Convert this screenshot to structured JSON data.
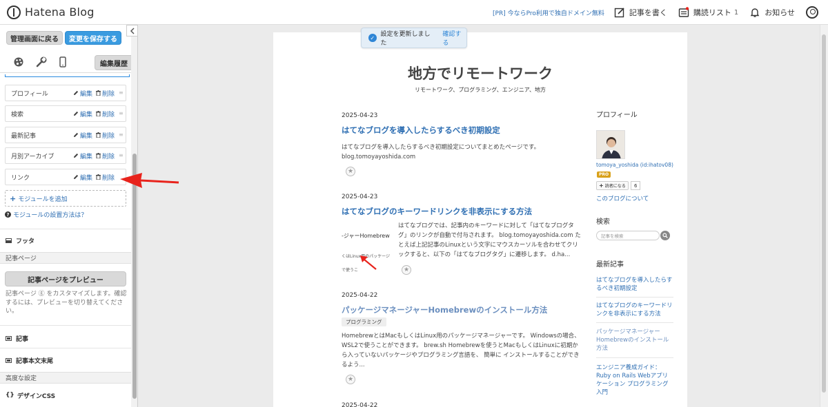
{
  "topbar": {
    "logo_text": "Hatena Blog",
    "pr_link": "[PR] 今ならPro利用で独自ドメイン無料",
    "write_label": "記事を書く",
    "subscribe_label": "購読リスト",
    "subscribe_count": "1",
    "notify_label": "お知らせ"
  },
  "sidebar": {
    "back_label": "管理画面に戻る",
    "save_label": "変更を保存する",
    "history_label": "編集履歴",
    "modules": [
      {
        "label": "プロフィール",
        "edit": "編集",
        "delete": "削除"
      },
      {
        "label": "検索",
        "edit": "編集",
        "delete": "削除"
      },
      {
        "label": "最新記事",
        "edit": "編集",
        "delete": "削除"
      },
      {
        "label": "月別アーカイブ",
        "edit": "編集",
        "delete": "削除"
      },
      {
        "label": "リンク",
        "edit": "編集",
        "delete": "削除"
      }
    ],
    "add_module": "モジュールを追加",
    "howto": "モジュールの設置方法は？",
    "footer_label": "フッタ",
    "article_page_group": "記事ページ",
    "preview_article_btn": "記事ページをプレビュー",
    "preview_desc": "記事ページ ⓖ をカスタマイズします。確認するには、プレビューを切り替えてください。",
    "article_label": "記事",
    "article_footer_label": "記事本文末尾",
    "advanced_group": "高度な設定",
    "design_css_label": "デザインCSS"
  },
  "toast": {
    "message": "設定を更新しました",
    "confirm_link": "確認する"
  },
  "blog": {
    "title": "地方でリモートワーク",
    "description": "リモートワーク、プログラミング、エンジニア、地方",
    "entries": [
      {
        "date": "2025-04-23",
        "title": "はてなブログを導入したらするべき初期設定",
        "body": "はてなブログを導入したらするべき初期設定についてまとめたページです。 blog.tomoyayoshida.com"
      },
      {
        "date": "2025-04-23",
        "title": "はてなブログのキーワードリンクを非表示にする方法",
        "body": "はてなブログでは、記事内のキーワードに対して「はてなブログタグ」のリンクが自動で付与されます。 blog.tomoyayoshida.com たとえば上記記事のLinuxという文字にマウスカーソルを合わせてクリックすると、以下の「はてなブログタグ」に遷移します。 d.ha...",
        "thumb_lines": [
          "-ジャーHomebrew",
          "くはLinux用のパッケージ",
          "で使うこ"
        ]
      },
      {
        "date": "2025-04-22",
        "title": "パッケージマネージャーHomebrewのインストール方法",
        "tag": "プログラミング",
        "body": "HomebrewとはMacもしくはLinux用のパッケージマネージャーです。 Windowsの場合、WSL2で使うことができます。 brew.sh Homebrewを使うとMacもしくはLinuxに初期から入っていないパッケージやプログラミング言語を、 簡単に インストールすることができるよう..."
      },
      {
        "date": "2025-04-22"
      }
    ],
    "widgets": {
      "profile_title": "プロフィール",
      "profile_name": "tomoya_yoshida (id:ihatov08)",
      "pro_badge": "PRO",
      "reader_btn": "読者になる",
      "reader_count": "6",
      "about_link": "このブログについて",
      "search_title": "検索",
      "search_placeholder": "記事を検索",
      "recent_title": "最新記事",
      "recent": [
        "はてなブログを導入したらするべき初期設定",
        "はてなブログのキーワードリンクを非表示にする方法",
        "パッケージマネージャーHomebrewのインストール方法",
        "エンジニア養成ガイド：Ruby on Rails Webアプリケーション プログラミング入門"
      ]
    }
  },
  "colors": {
    "accent": "#3a9be0",
    "link": "#2f6fb3",
    "arrow": "#e8231c",
    "pro": "#d9a11a"
  }
}
